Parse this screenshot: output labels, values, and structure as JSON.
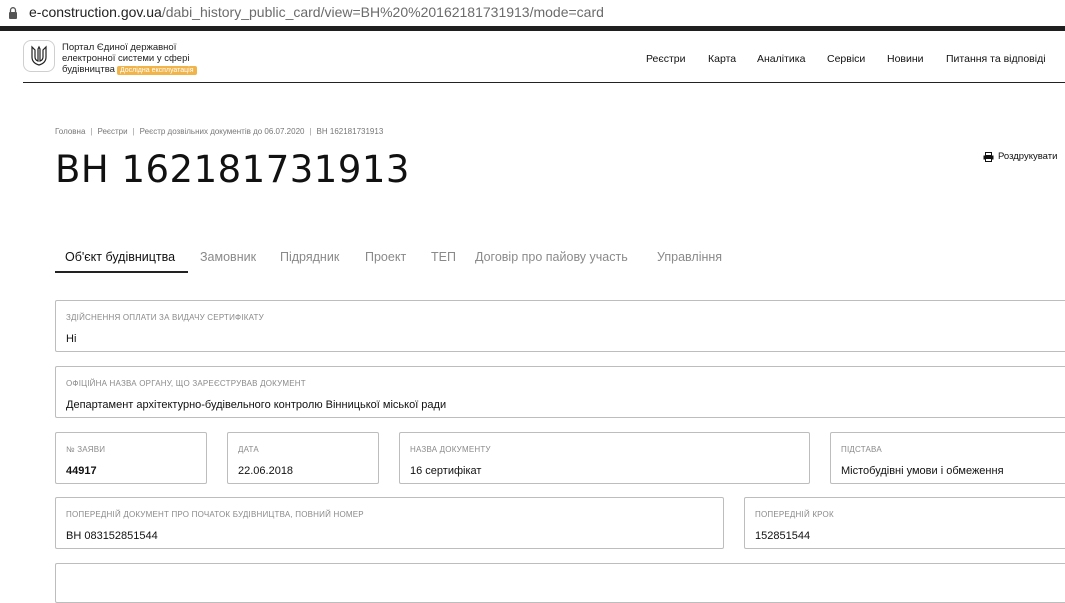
{
  "browser": {
    "url_domain": "e-construction.gov.ua",
    "url_rest": "/dabi_history_public_card/view=ВН%20%20162181731913/mode=card"
  },
  "header": {
    "portal_title": "Портал Єдиної державної електронної системи у сфері будівництва",
    "badge": "Дослідна експлуатація",
    "nav": [
      "Реєстри",
      "Карта",
      "Аналітика",
      "Сервіси",
      "Новини",
      "Питання та відповіді"
    ]
  },
  "breadcrumb": [
    "Головна",
    "Реєстри",
    "Реєстр дозвільних документів до 06.07.2020",
    "ВН 162181731913"
  ],
  "page": {
    "title": "ВН 162181731913",
    "print_label": "Роздрукувати"
  },
  "tabs": [
    "Об'єкт будівництва",
    "Замовник",
    "Підрядник",
    "Проект",
    "ТЕП",
    "Договір про пайову участь",
    "Управління"
  ],
  "fields": {
    "payment": {
      "label": "Здійснення оплати за видачу сертифікату",
      "value": "Ні"
    },
    "authority": {
      "label": "Офіційна назва органу, що зареєстрував документ",
      "value": "Департамент архітектурно-будівельного контролю Вінницької міської ради"
    },
    "application_no": {
      "label": "№ заяви",
      "value": "44917"
    },
    "date": {
      "label": "Дата",
      "value": "22.06.2018"
    },
    "doc_name": {
      "label": "Назва документу",
      "value": "16 сертифікат"
    },
    "basis": {
      "label": "Підстава",
      "value": "Містобудівні умови і обмеження"
    },
    "prev_doc": {
      "label": "Попередній документ про початок будівництва, повний номер",
      "value": "ВН 083152851544"
    },
    "prev_step": {
      "label": "Попередній крок",
      "value": "152851544"
    }
  },
  "colors": {
    "badge": "#f0b44a",
    "border": "#bdbdbd",
    "muted": "#8a8a8a"
  }
}
